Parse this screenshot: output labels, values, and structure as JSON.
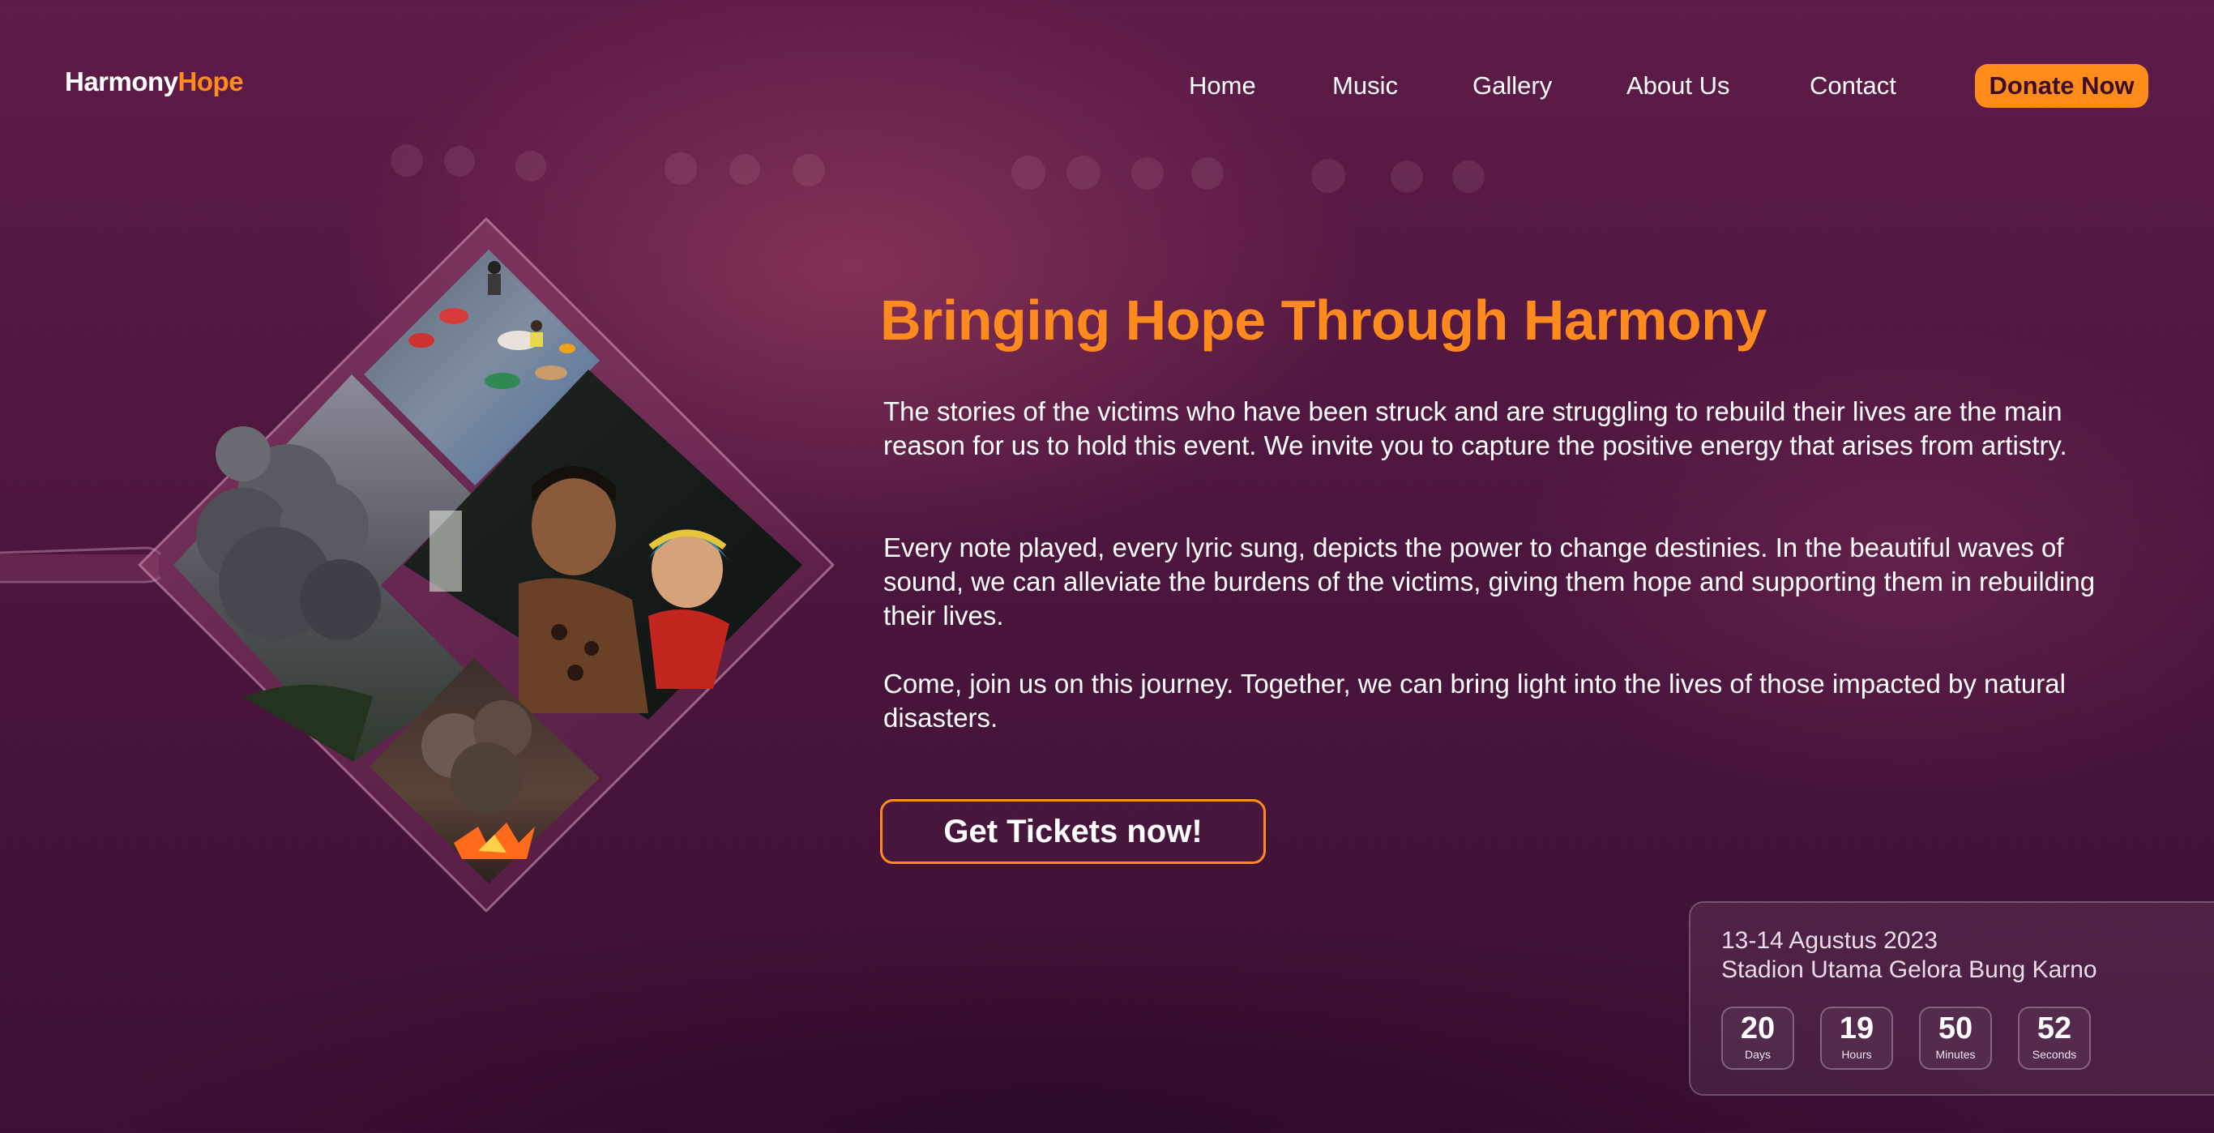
{
  "brand": {
    "part_a": "Harmony",
    "part_b": "Hope"
  },
  "nav": {
    "items": [
      {
        "label": "Home"
      },
      {
        "label": "Music"
      },
      {
        "label": "Gallery"
      },
      {
        "label": "About Us"
      },
      {
        "label": "Contact"
      }
    ],
    "donate_label": "Donate Now"
  },
  "hero": {
    "title": "Bringing Hope Through Harmony",
    "paragraphs": [
      "The stories of the victims who have been struck and are struggling to rebuild their lives are the main reason for us to hold this event. We invite you to capture the positive energy that arises from artistry.",
      "Every note played, every lyric sung, depicts the power to change destinies. In the beautiful waves of sound, we can alleviate the burdens of the victims, giving them hope and supporting them in rebuilding their lives.",
      "Come, join us on this journey. Together, we can bring light into the lives of those impacted by natural disasters."
    ],
    "cta_label": "Get Tickets now!"
  },
  "event": {
    "date": "13-14 Agustus 2023",
    "venue": "Stadion Utama Gelora Bung Karno",
    "countdown": [
      {
        "value": "20",
        "label": "Days"
      },
      {
        "value": "19",
        "label": "Hours"
      },
      {
        "value": "50",
        "label": "Minutes"
      },
      {
        "value": "52",
        "label": "Seconds"
      }
    ]
  },
  "colors": {
    "accent": "#ff8a1d",
    "background": "#4d163f"
  }
}
